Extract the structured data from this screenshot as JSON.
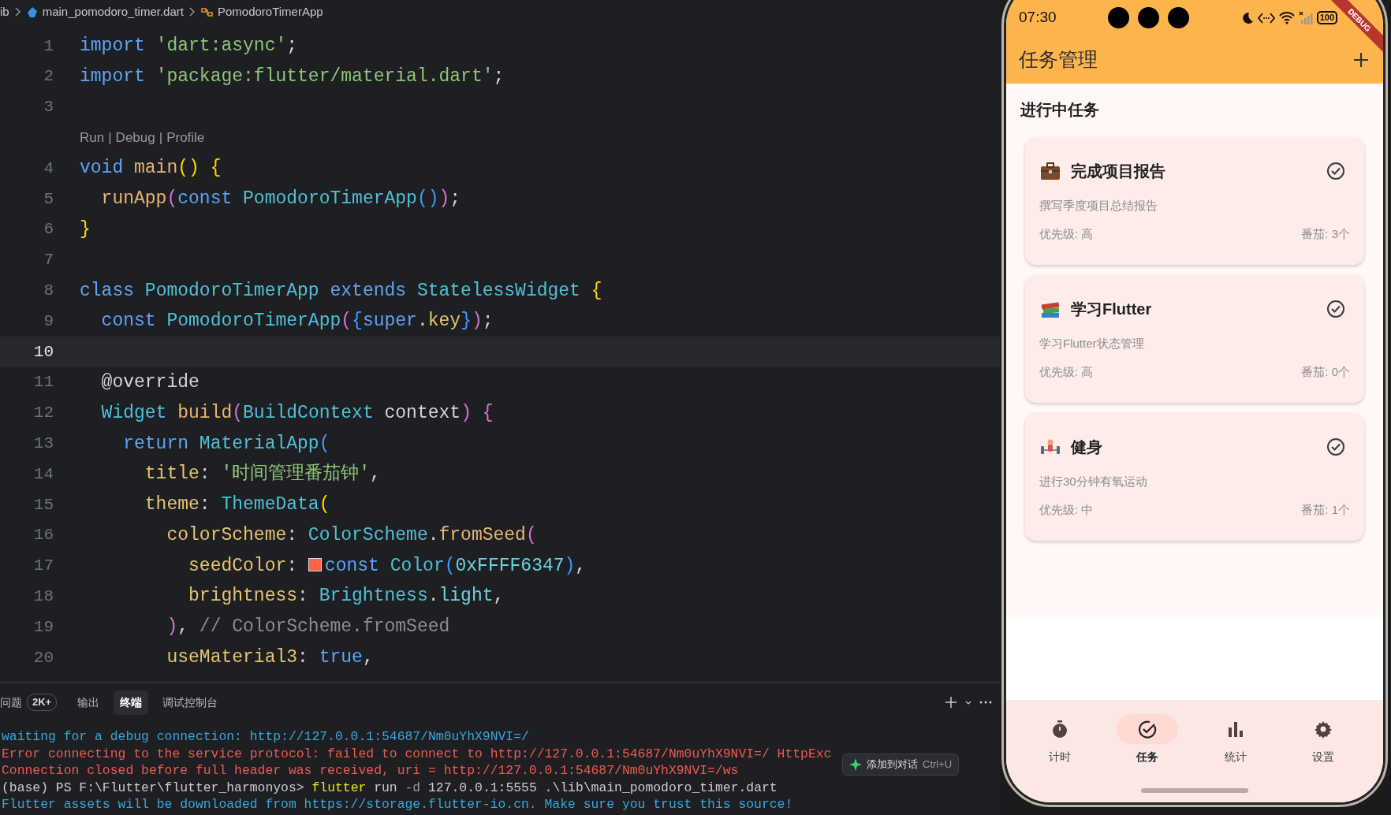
{
  "breadcrumb": [
    {
      "text": "ib",
      "kind": "folder"
    },
    {
      "text": "main_pomodoro_timer.dart",
      "kind": "file"
    },
    {
      "text": "PomodoroTimerApp",
      "kind": "class"
    }
  ],
  "editor": {
    "lines": [
      {
        "kind": "code",
        "number": "1",
        "current": false,
        "tokens": [
          {
            "text": "import ",
            "kind": "kw"
          },
          {
            "text": "'dart:async'",
            "kind": "str"
          },
          {
            "text": ";",
            "kind": "p"
          }
        ]
      },
      {
        "kind": "code",
        "number": "2",
        "current": false,
        "tokens": [
          {
            "text": "import ",
            "kind": "kw"
          },
          {
            "text": "'package:flutter/material.dart'",
            "kind": "str"
          },
          {
            "text": ";",
            "kind": "p"
          }
        ]
      },
      {
        "kind": "code",
        "number": "3",
        "current": false
      },
      {
        "kind": "codelens",
        "links": [
          "Run",
          "Debug",
          "Profile"
        ],
        "separator": "|"
      },
      {
        "kind": "code",
        "number": "4",
        "current": false,
        "tokens": [
          {
            "text": "void ",
            "kind": "kw"
          },
          {
            "text": "main",
            "kind": "fn"
          },
          {
            "text": "() {",
            "kind": "b1"
          }
        ]
      },
      {
        "kind": "code",
        "number": "5",
        "current": false,
        "tokens": [
          {
            "text": "  runApp",
            "kind": "fn"
          },
          {
            "text": "(",
            "kind": "b2"
          },
          {
            "text": "const ",
            "kind": "kw"
          },
          {
            "text": "PomodoroTimerApp",
            "kind": "cls"
          },
          {
            "text": "()",
            "kind": "b3"
          },
          {
            "text": ")",
            "kind": "b2"
          },
          {
            "text": ";",
            "kind": "p"
          }
        ]
      },
      {
        "kind": "code",
        "number": "6",
        "current": false,
        "tokens": [
          {
            "text": "}",
            "kind": "b1"
          }
        ]
      },
      {
        "kind": "code",
        "number": "7",
        "current": false
      },
      {
        "kind": "code",
        "number": "8",
        "current": false,
        "tokens": [
          {
            "text": "class ",
            "kind": "kw"
          },
          {
            "text": "PomodoroTimerApp ",
            "kind": "cls"
          },
          {
            "text": "extends ",
            "kind": "kw"
          },
          {
            "text": "StatelessWidget ",
            "kind": "cls"
          },
          {
            "text": "{",
            "kind": "b1"
          }
        ]
      },
      {
        "kind": "code",
        "number": "9",
        "current": false,
        "tokens": [
          {
            "text": "  const ",
            "kind": "kw"
          },
          {
            "text": "PomodoroTimerApp",
            "kind": "cls"
          },
          {
            "text": "(",
            "kind": "b2"
          },
          {
            "text": "{",
            "kind": "b3"
          },
          {
            "text": "super",
            "kind": "kw"
          },
          {
            "text": ".",
            "kind": "p"
          },
          {
            "text": "key",
            "kind": "prop"
          },
          {
            "text": "}",
            "kind": "b3"
          },
          {
            "text": ")",
            "kind": "b2"
          },
          {
            "text": ";",
            "kind": "p"
          }
        ]
      },
      {
        "kind": "code",
        "number": "10",
        "current": true
      },
      {
        "kind": "code",
        "number": "11",
        "current": false,
        "tokens": [
          {
            "text": "  @override",
            "kind": "p"
          }
        ]
      },
      {
        "kind": "code",
        "number": "12",
        "current": false,
        "tokens": [
          {
            "text": "  Widget ",
            "kind": "cls"
          },
          {
            "text": "build",
            "kind": "fn"
          },
          {
            "text": "(",
            "kind": "b2"
          },
          {
            "text": "BuildContext",
            "kind": "cls"
          },
          {
            "text": " context",
            "kind": "var"
          },
          {
            "text": ") {",
            "kind": "b2"
          }
        ]
      },
      {
        "kind": "code",
        "number": "13",
        "current": false,
        "tokens": [
          {
            "text": "    return ",
            "kind": "kw"
          },
          {
            "text": "MaterialApp",
            "kind": "cls"
          },
          {
            "text": "(",
            "kind": "b3"
          }
        ]
      },
      {
        "kind": "code",
        "number": "14",
        "current": false,
        "tokens": [
          {
            "text": "      title",
            "kind": "prop"
          },
          {
            "text": ": ",
            "kind": "p"
          },
          {
            "text": "'时间管理番茄钟'",
            "kind": "str"
          },
          {
            "text": ",",
            "kind": "p"
          }
        ]
      },
      {
        "kind": "code",
        "number": "15",
        "current": false,
        "tokens": [
          {
            "text": "      theme",
            "kind": "prop"
          },
          {
            "text": ": ",
            "kind": "p"
          },
          {
            "text": "ThemeData",
            "kind": "cls"
          },
          {
            "text": "(",
            "kind": "b1"
          }
        ]
      },
      {
        "kind": "code",
        "number": "16",
        "current": false,
        "tokens": [
          {
            "text": "        colorScheme",
            "kind": "prop"
          },
          {
            "text": ": ",
            "kind": "p"
          },
          {
            "text": "ColorScheme",
            "kind": "cls"
          },
          {
            "text": ".",
            "kind": "p"
          },
          {
            "text": "fromSeed",
            "kind": "fn"
          },
          {
            "text": "(",
            "kind": "b2"
          }
        ]
      },
      {
        "kind": "code",
        "number": "17",
        "current": false,
        "tokens": [
          {
            "text": "          seedColor",
            "kind": "prop"
          },
          {
            "text": ": ",
            "kind": "p"
          },
          {
            "kind": "swatch",
            "color": "#ff6347"
          },
          {
            "text": "const ",
            "kind": "kw"
          },
          {
            "text": "Color",
            "kind": "cls"
          },
          {
            "text": "(",
            "kind": "b3"
          },
          {
            "text": "0xFFFF6347",
            "kind": "num"
          },
          {
            "text": ")",
            "kind": "b3"
          },
          {
            "text": ",",
            "kind": "p"
          }
        ]
      },
      {
        "kind": "code",
        "number": "18",
        "current": false,
        "tokens": [
          {
            "text": "          brightness",
            "kind": "prop"
          },
          {
            "text": ": ",
            "kind": "p"
          },
          {
            "text": "Brightness",
            "kind": "cls"
          },
          {
            "text": ".",
            "kind": "p"
          },
          {
            "text": "light",
            "kind": "num"
          },
          {
            "text": ",",
            "kind": "p"
          }
        ]
      },
      {
        "kind": "code",
        "number": "19",
        "current": false,
        "tokens": [
          {
            "text": "        )",
            "kind": "b2"
          },
          {
            "text": ", ",
            "kind": "p"
          },
          {
            "text": "// ColorScheme.fromSeed",
            "kind": "cmt"
          }
        ]
      },
      {
        "kind": "code",
        "number": "20",
        "current": false,
        "tokens": [
          {
            "text": "        useMaterial3",
            "kind": "prop"
          },
          {
            "text": ": ",
            "kind": "p"
          },
          {
            "text": "true",
            "kind": "kw"
          },
          {
            "text": ",",
            "kind": "p"
          }
        ]
      }
    ]
  },
  "panel": {
    "tabs": [
      {
        "label": "问题",
        "badge": "2K+",
        "selected": false
      },
      {
        "label": "输出",
        "selected": false
      },
      {
        "label": "终端",
        "selected": true
      },
      {
        "label": "调试控制台",
        "selected": false
      }
    ],
    "terminal": [
      {
        "tokens": [
          {
            "text": "waiting for a debug connection: http://127.0.0.1:54687/Nm0uYhX9NVI=/",
            "kind": "info"
          }
        ]
      },
      {
        "tokens": [
          {
            "text": "Error connecting to the service protocol: failed to connect to http://127.0.0.1:54687/Nm0uYhX9NVI=/ HttpExc",
            "kind": "error"
          }
        ]
      },
      {
        "tokens": [
          {
            "text": "Connection closed before full header was received, uri = http://127.0.0.1:54687/Nm0uYhX9NVI=/ws",
            "kind": "error"
          }
        ]
      },
      {
        "tokens": [
          {
            "text": "(base) PS F:\\Flutter\\flutter_harmonyos> ",
            "kind": "plain"
          },
          {
            "text": "flutter",
            "kind": "cmd"
          },
          {
            "text": " run ",
            "kind": "plain"
          },
          {
            "text": "-d",
            "kind": "flag"
          },
          {
            "text": " 127.0.0.1:5555 .\\lib\\main_pomodoro_timer.dart",
            "kind": "plain"
          }
        ]
      },
      {
        "tokens": [
          {
            "text": "Flutter assets will be downloaded from https://storage.flutter-io.cn. Make sure you trust this source!",
            "kind": "info"
          }
        ]
      }
    ],
    "popup": {
      "label": "添加到对话",
      "shortcut": "Ctrl+U"
    }
  },
  "phone": {
    "status": {
      "time": "07:30",
      "battery": "100"
    },
    "debug_banner": "DEBUG",
    "app_bar": {
      "title": "任务管理"
    },
    "section_title": "进行中任务",
    "tasks": [
      {
        "title": "完成项目报告",
        "description": "撰写季度项目总结报告",
        "priority": "优先级: 高",
        "pomodoros": "番茄: 3个"
      },
      {
        "title": "学习Flutter",
        "description": "学习Flutter状态管理",
        "priority": "优先级: 高",
        "pomodoros": "番茄: 0个"
      },
      {
        "title": "健身",
        "description": "进行30分钟有氧运动",
        "priority": "优先级: 中",
        "pomodoros": "番茄: 1个"
      }
    ],
    "nav": [
      {
        "label": "计时",
        "selected": false
      },
      {
        "label": "任务",
        "selected": true
      },
      {
        "label": "统计",
        "selected": false
      },
      {
        "label": "设置",
        "selected": false
      }
    ]
  }
}
